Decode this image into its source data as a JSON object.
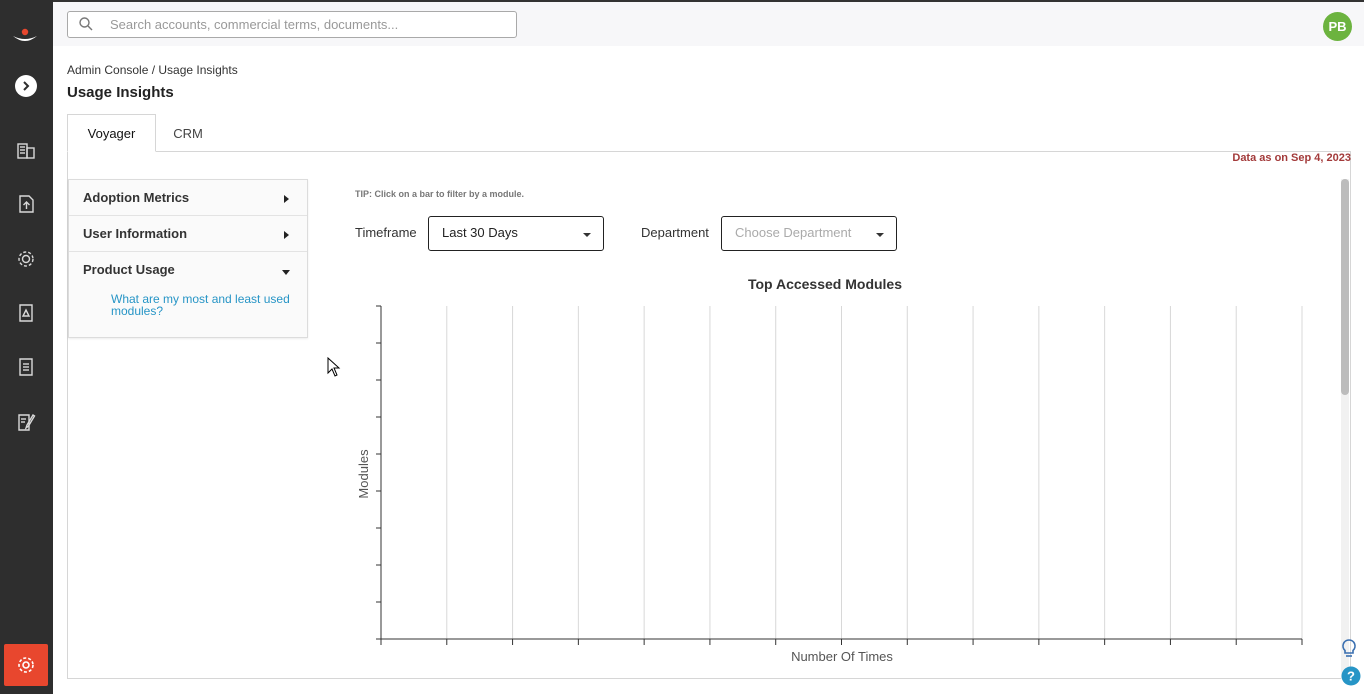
{
  "search": {
    "placeholder": "Search accounts, commercial terms, documents..."
  },
  "user": {
    "initials": "PB"
  },
  "breadcrumb": "Admin Console / Usage Insights",
  "page_title": "Usage Insights",
  "tabs": [
    {
      "label": "Voyager",
      "active": true
    },
    {
      "label": "CRM",
      "active": false
    }
  ],
  "data_date": "Data as on Sep 4, 2023",
  "sidebar": {
    "items": [
      {
        "label": "Adoption Metrics",
        "state": "collapsed"
      },
      {
        "label": "User Information",
        "state": "collapsed"
      },
      {
        "label": "Product Usage",
        "state": "expanded"
      }
    ],
    "sub_link": "What are my most and least used modules?"
  },
  "tip": "TIP: Click on a bar to filter by a module.",
  "filters": {
    "timeframe_label": "Timeframe",
    "timeframe_value": "Last 30 Days",
    "department_label": "Department",
    "department_placeholder": "Choose Department"
  },
  "chart_data": {
    "type": "bar",
    "title": "Top Accessed Modules",
    "xlabel": "Number Of Times",
    "ylabel": "Modules",
    "categories": [],
    "values": [],
    "grid": "vertical"
  },
  "colors": {
    "rail": "#2e2e2e",
    "accent": "#e8472e",
    "avatar": "#6cb33f",
    "link": "#2795c6",
    "date": "#a33a3a"
  }
}
